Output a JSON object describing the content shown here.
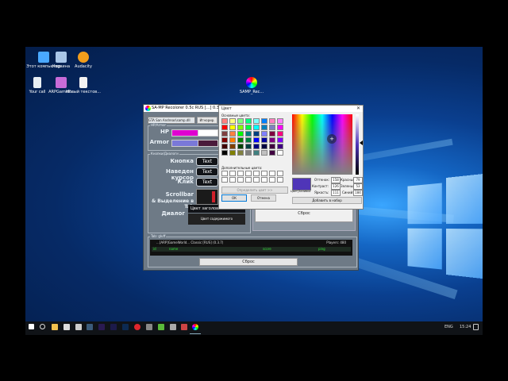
{
  "desktop": {
    "icons": [
      {
        "label": "Этот компьютер",
        "color": "#4aa8ff"
      },
      {
        "label": "Корзина",
        "color": "#a9c6e8"
      },
      {
        "label": "Audacity",
        "color": "#f29d1c"
      },
      {
        "label": "Your call",
        "color": "#e8eef4"
      },
      {
        "label": "ARPGameP...",
        "color": "#c86bd8"
      },
      {
        "label": "Новый текстов...",
        "color": "#f2f2f2"
      },
      {
        "label": "SAMP_Rec...",
        "color": "#ff9f1c"
      }
    ]
  },
  "samp_window": {
    "title": "SA-MP Recolorer 0.5c RUS [...] 0.3c R3 ...",
    "top_field": "GTA San Andreas\\samp.dll",
    "top_button": "Игнорир.",
    "group_hp": "HP/Armor",
    "hp_label": "HP",
    "armor_label": "Armor",
    "hp_color": "#e000d0",
    "armor_color": "#7a78d8",
    "group_buttons": "Кнопки/Диалоги",
    "rows": [
      {
        "label": "Кнопка",
        "pill": "Text"
      },
      {
        "label": "Наведен курсор",
        "pill": "Text"
      },
      {
        "label": "Клик",
        "pill": "Text"
      }
    ],
    "scrollbar_label_1": "Scrollbar",
    "scrollbar_label_2": "& Выделение в Tab",
    "dialog_label": "Диалог",
    "dialog_header": "Цвет заголовка",
    "dialog_content": "Цвет содержимого",
    "reset_1": "Сброс",
    "group_tab": "Tab: gluff",
    "tab_server": "...[ARP]GameWorld... Classic [RUS] (0.3.7)",
    "tab_players": "Players: 480",
    "tab_cols": [
      "id",
      "name",
      "score",
      "ping"
    ],
    "reset_2": "Сброс"
  },
  "color_dialog": {
    "title": "Цвет",
    "basic_colors_label": "Основные цвета:",
    "custom_colors_label": "Дополнительные цвета:",
    "define_button": "Определить цвет >>",
    "ok": "ОК",
    "cancel": "Отмена",
    "hue_label": "Оттенок:",
    "sat_label": "Контраст:",
    "lum_label": "Яркость:",
    "red_label": "Красный:",
    "green_label": "Зеленый:",
    "blue_label": "Синий:",
    "hue": "158",
    "sat": "126",
    "lum": "111",
    "red": "79",
    "green": "53",
    "blue": "184",
    "solid_label": "Цвет|Заливка",
    "add_button": "Добавить в набор",
    "selected_color": "#4f35b8",
    "basic_colors": [
      "#ff8080",
      "#ffff80",
      "#80ff80",
      "#00ff80",
      "#80ffff",
      "#0080ff",
      "#ff80c0",
      "#ff80ff",
      "#ff0000",
      "#ffff00",
      "#80ff00",
      "#00ff40",
      "#00ffff",
      "#0080c0",
      "#8080c0",
      "#ff00ff",
      "#804040",
      "#ff8040",
      "#00ff00",
      "#008080",
      "#004080",
      "#8080ff",
      "#800040",
      "#ff0080",
      "#800000",
      "#ff8000",
      "#008000",
      "#008040",
      "#0000ff",
      "#0000a0",
      "#800080",
      "#8000ff",
      "#400000",
      "#804000",
      "#004000",
      "#004040",
      "#000080",
      "#000040",
      "#400040",
      "#400080",
      "#000000",
      "#808000",
      "#808040",
      "#808080",
      "#408080",
      "#c0c0c0",
      "#400040",
      "#ffffff"
    ]
  },
  "taskbar": {
    "lang": "ENG",
    "time": "15:24"
  }
}
